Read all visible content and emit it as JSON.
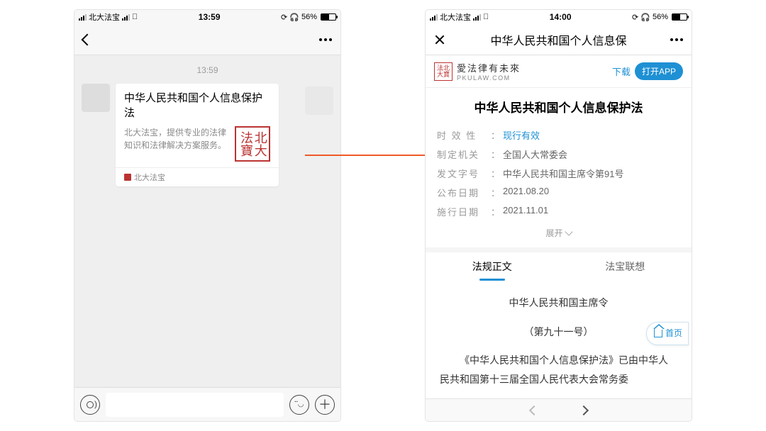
{
  "status": {
    "carrier": "北大法宝",
    "wifi": "􀙇",
    "battery_pct": "56%",
    "headset": "♫"
  },
  "left": {
    "time": "13:59",
    "msg_time": "13:59",
    "card": {
      "title": "中华人民共和国个人信息保护法",
      "desc": "北大法宝，提供专业的法律知识和法律解决方案服务。",
      "seal": "北大法寶",
      "source": "北大法宝"
    }
  },
  "right": {
    "time": "14:00",
    "nav_title": "中华人民共和国个人信息保",
    "brand_cn": "愛法律有未來",
    "brand_en": "PKULAW.COM",
    "brand_seal": "法北大寶",
    "download": "下载",
    "open_app": "打开APP",
    "doc_title": "中华人民共和国个人信息保护法",
    "meta": [
      {
        "label": "时 效 性",
        "value": "现行有效",
        "link": true
      },
      {
        "label": "制定机关",
        "value": "全国人大常委会"
      },
      {
        "label": "发文字号",
        "value": "中华人民共和国主席令第91号"
      },
      {
        "label": "公布日期",
        "value": "2021.08.20"
      },
      {
        "label": "施行日期",
        "value": "2021.11.01"
      }
    ],
    "expand": "展开",
    "tabs": [
      "法规正文",
      "法宝联想"
    ],
    "content": {
      "line1": "中华人民共和国主席令",
      "line2": "（第九十一号）",
      "body": "《中华人民共和国个人信息保护法》已由中华人民共和国第十三届全国人民代表大会常务委"
    },
    "home": "首页"
  }
}
